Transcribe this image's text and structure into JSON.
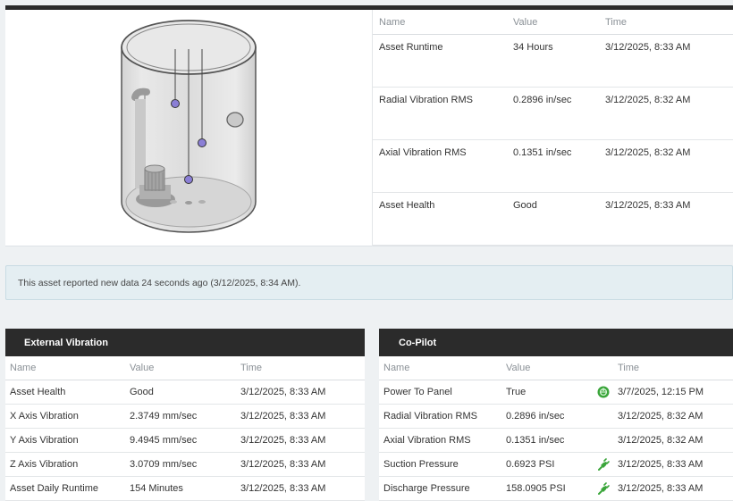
{
  "sensor_table": {
    "headers": {
      "name": "Name",
      "value": "Value",
      "time": "Time"
    },
    "rows": [
      {
        "name": "Asset Runtime",
        "value": "34 Hours",
        "time": "3/12/2025, 8:33 AM"
      },
      {
        "name": "Radial Vibration RMS",
        "value": "0.2896 in/sec",
        "time": "3/12/2025, 8:32 AM"
      },
      {
        "name": "Axial Vibration RMS",
        "value": "0.1351 in/sec",
        "time": "3/12/2025, 8:32 AM"
      },
      {
        "name": "Asset Health",
        "value": "Good",
        "time": "3/12/2025, 8:33 AM"
      }
    ]
  },
  "notice": {
    "text": "This asset reported new data 24 seconds ago (3/12/2025, 8:34 AM)."
  },
  "external_vibration": {
    "title": "External Vibration",
    "headers": {
      "name": "Name",
      "value": "Value",
      "time": "Time"
    },
    "rows": [
      {
        "name": "Asset Health",
        "value": "Good",
        "time": "3/12/2025, 8:33 AM"
      },
      {
        "name": "X Axis Vibration",
        "value": "2.3749 mm/sec",
        "time": "3/12/2025, 8:33 AM"
      },
      {
        "name": "Y Axis Vibration",
        "value": "9.4945 mm/sec",
        "time": "3/12/2025, 8:33 AM"
      },
      {
        "name": "Z Axis Vibration",
        "value": "3.0709 mm/sec",
        "time": "3/12/2025, 8:33 AM"
      },
      {
        "name": "Asset Daily Runtime",
        "value": "154 Minutes",
        "time": "3/12/2025, 8:33 AM"
      }
    ]
  },
  "copilot": {
    "title": "Co-Pilot",
    "headers": {
      "name": "Name",
      "value": "Value",
      "time": "Time"
    },
    "rows": [
      {
        "name": "Power To Panel",
        "value": "True",
        "icon": "power-on-icon",
        "time": "3/7/2025, 12:15 PM"
      },
      {
        "name": "Radial Vibration RMS",
        "value": "0.2896 in/sec",
        "icon": "",
        "time": "3/12/2025, 8:32 AM"
      },
      {
        "name": "Axial Vibration RMS",
        "value": "0.1351 in/sec",
        "icon": "",
        "time": "3/12/2025, 8:32 AM"
      },
      {
        "name": "Suction Pressure",
        "value": "0.6923 PSI",
        "icon": "plug-icon",
        "time": "3/12/2025, 8:33 AM"
      },
      {
        "name": "Discharge Pressure",
        "value": "158.0905 PSI",
        "icon": "plug-icon",
        "time": "3/12/2025, 8:33 AM"
      }
    ]
  },
  "colors": {
    "header_bg": "#2b2b2b",
    "notice_bg": "#e4eef2",
    "icon_green": "#3aa53a",
    "sensor_purple": "#8b7fd6"
  }
}
